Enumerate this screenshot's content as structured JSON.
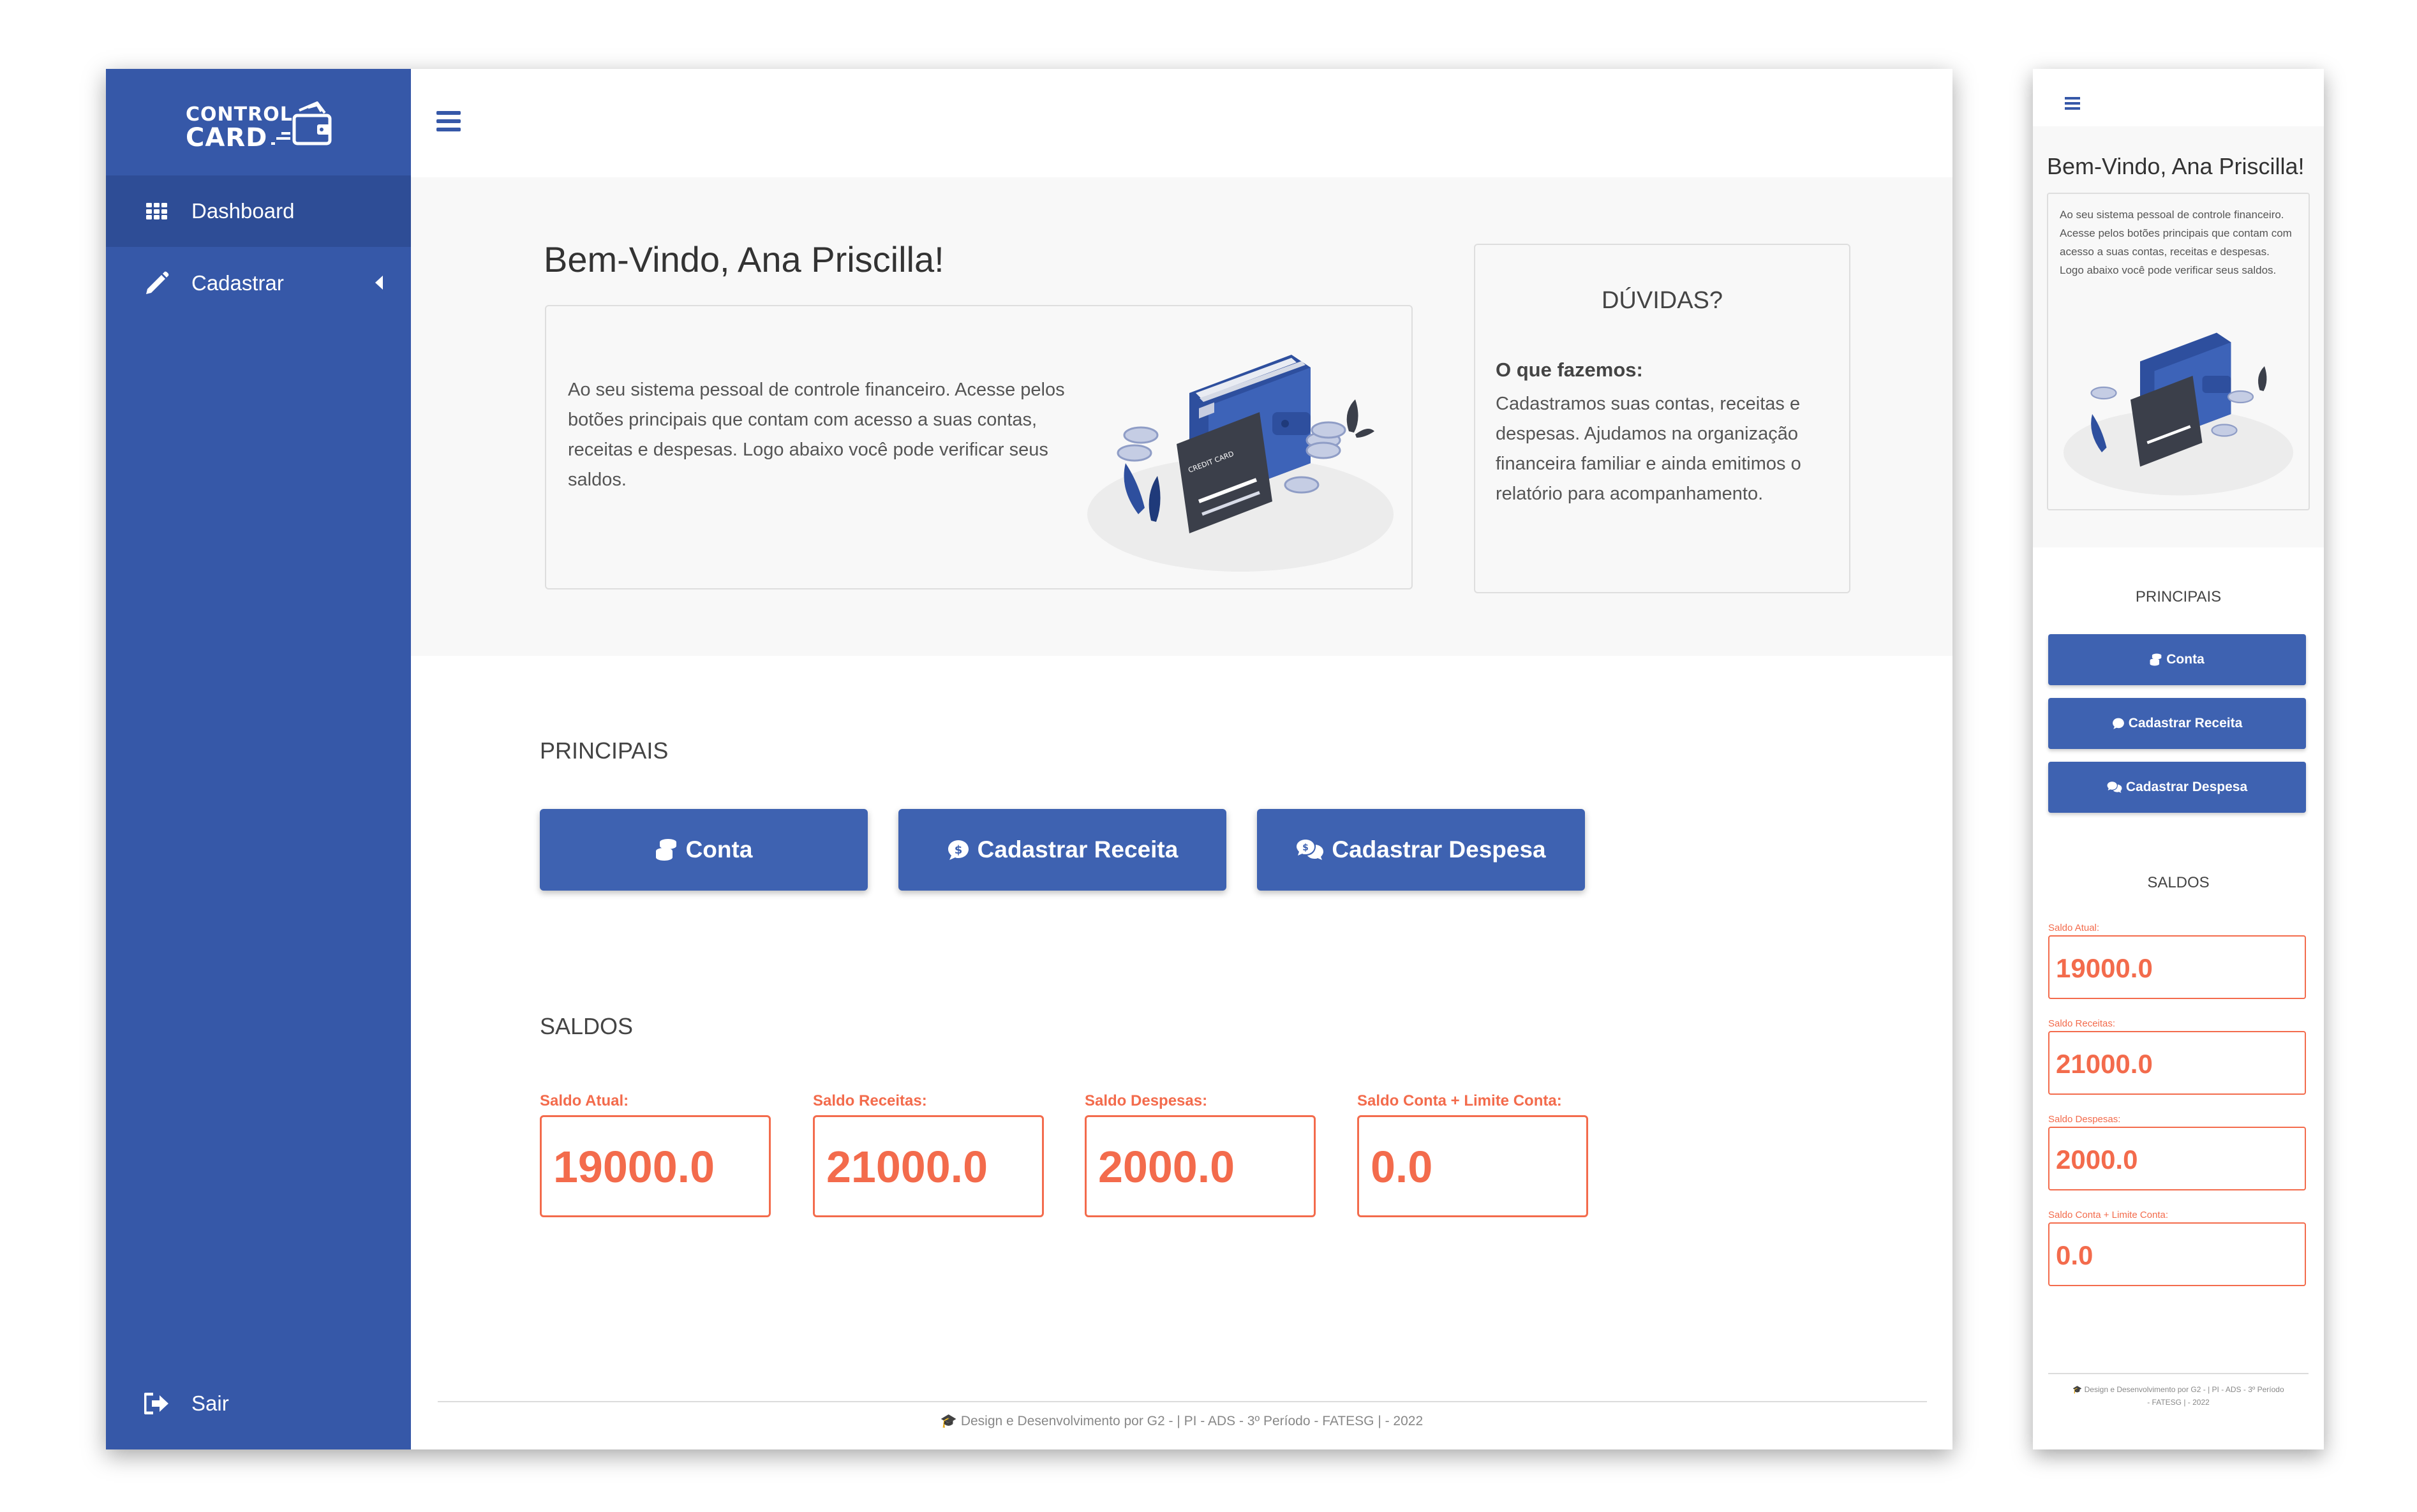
{
  "brand": {
    "line1": "CONTROL",
    "line2": "CARD"
  },
  "sidebar": {
    "items": [
      {
        "label": "Dashboard",
        "icon": "grid-icon"
      },
      {
        "label": "Cadastrar",
        "icon": "pencil-icon"
      }
    ],
    "logout_label": "Sair"
  },
  "welcome": {
    "title": "Bem-Vindo, Ana Priscilla!",
    "text": "Ao seu sistema pessoal de controle financeiro. Acesse pelos botões principais que contam com acesso a suas contas, receitas e despesas. Logo abaixo você pode verificar seus saldos."
  },
  "faq": {
    "title": "DÚVIDAS?",
    "subtitle": "O que fazemos:",
    "text": "Cadastramos suas contas, receitas e despesas. Ajudamos na organização financeira familiar e ainda emitimos o relatório para acompanhamento."
  },
  "illustration": {
    "card_text": "CREDIT CARD"
  },
  "principais": {
    "title": "PRINCIPAIS",
    "buttons": [
      {
        "label": "Conta",
        "icon": "coins-icon"
      },
      {
        "label": "Cadastrar Receita",
        "icon": "dollar-comment-icon"
      },
      {
        "label": "Cadastrar Despesa",
        "icon": "comments-dollar-icon"
      }
    ]
  },
  "saldos": {
    "title": "SALDOS",
    "items": [
      {
        "label": "Saldo Atual:",
        "value": "19000.0"
      },
      {
        "label": "Saldo Receitas:",
        "value": "21000.0"
      },
      {
        "label": "Saldo Despesas:",
        "value": "2000.0"
      },
      {
        "label": "Saldo Conta + Limite Conta:",
        "value": "0.0"
      }
    ]
  },
  "footer": {
    "text": "Design e Desenvolvimento por G2 - | PI - ADS - 3º Período - FATESG | - 2022"
  },
  "colors": {
    "primary": "#3658a8",
    "button": "#3e62b1",
    "accent": "#f36b4c",
    "hero_bg": "#f8f8f8"
  }
}
